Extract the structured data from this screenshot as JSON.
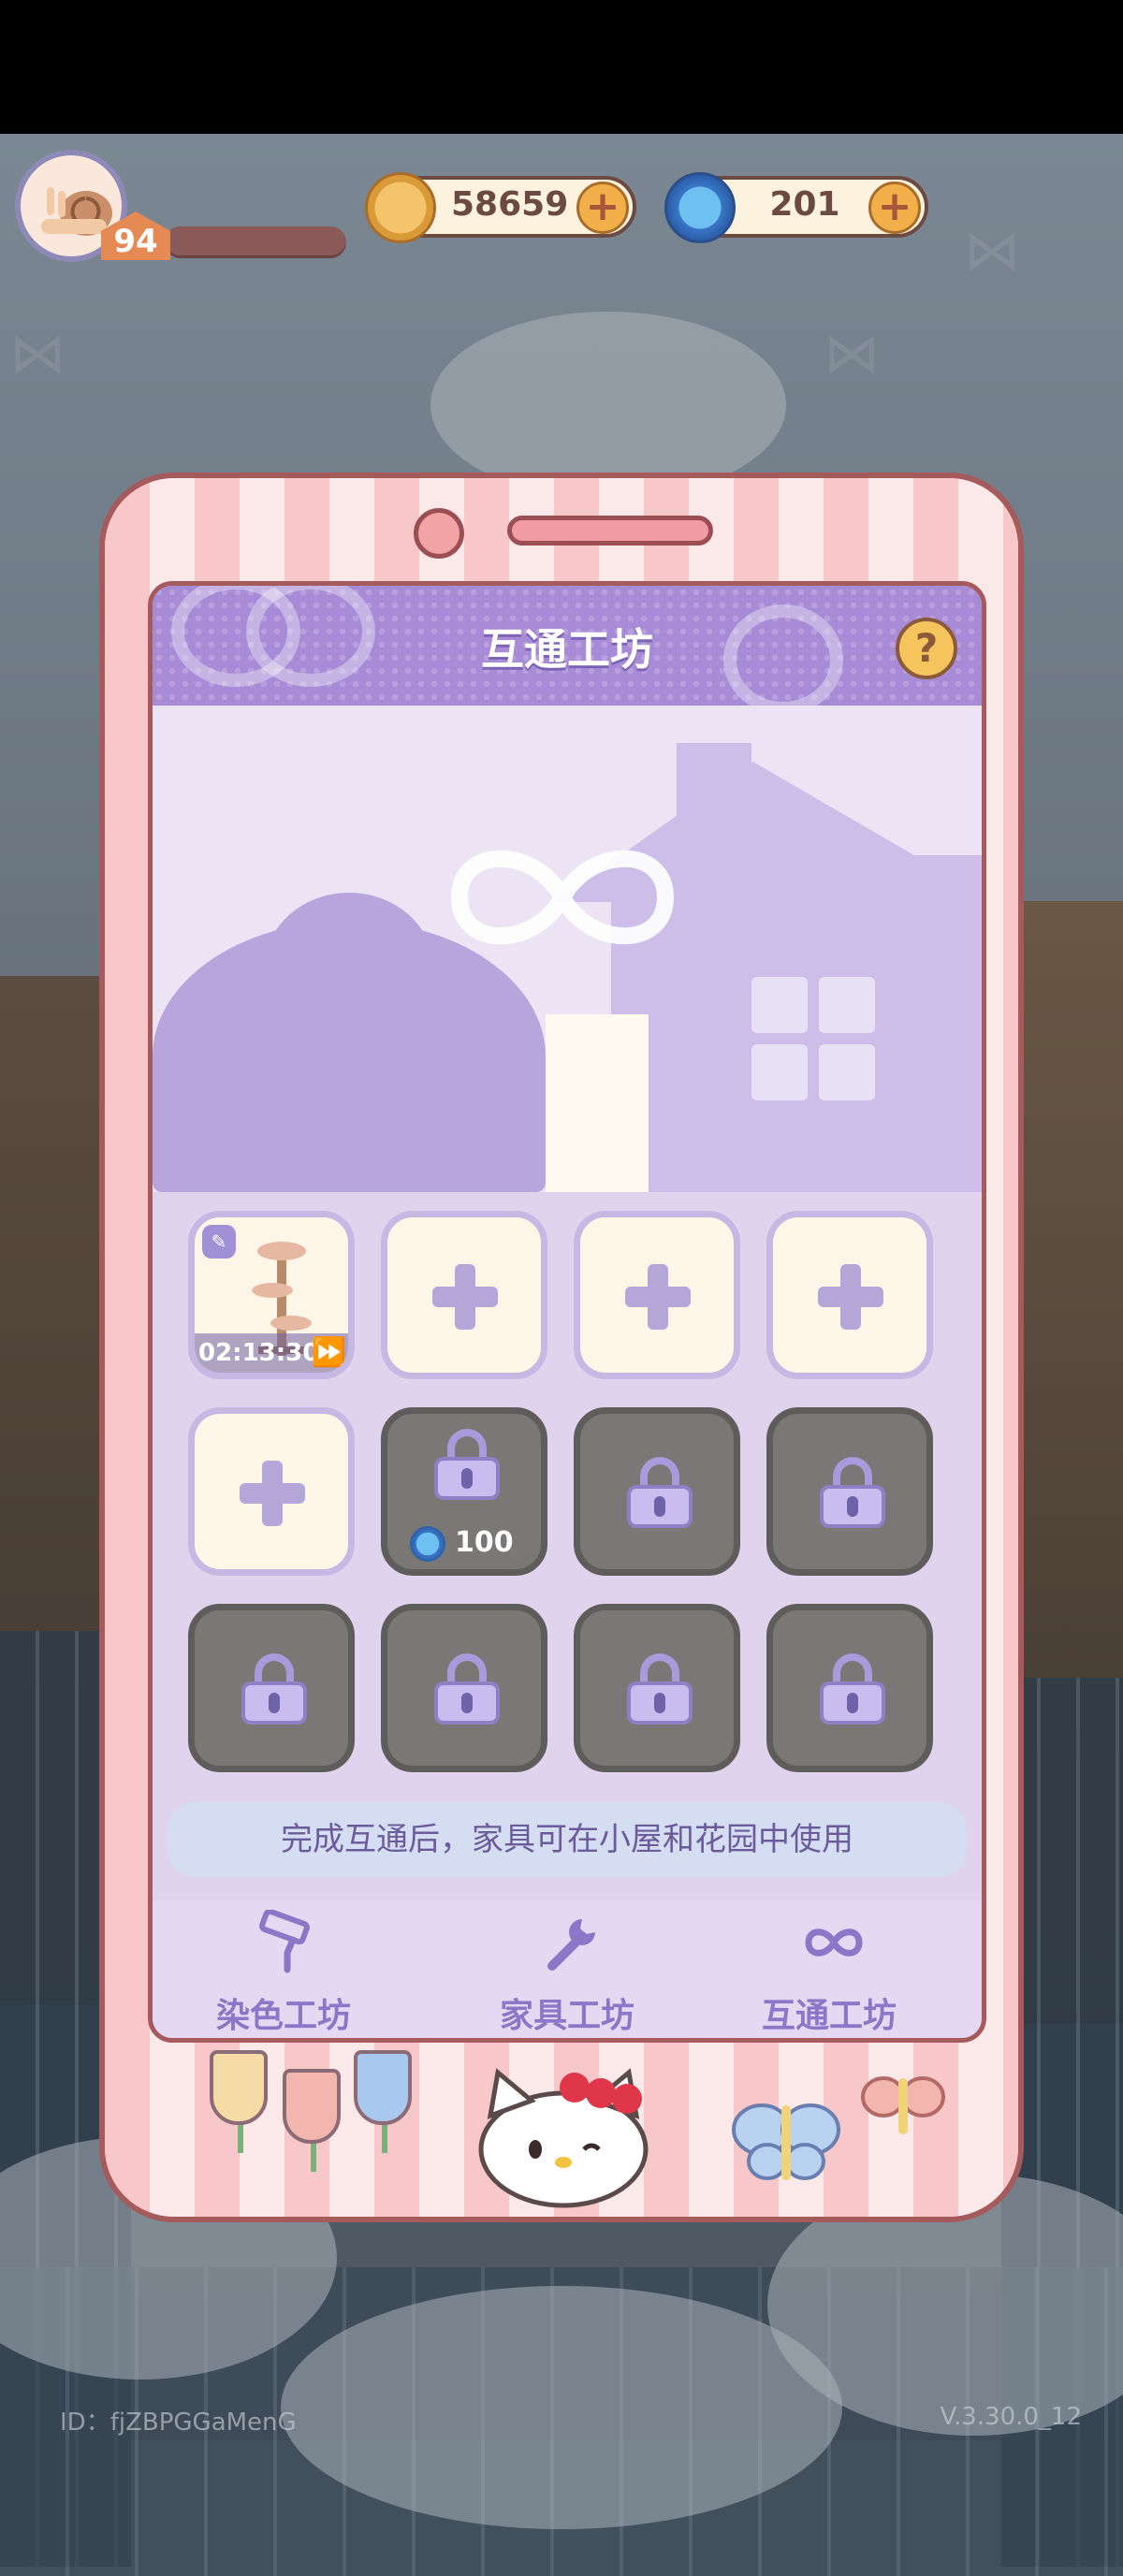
{
  "hud": {
    "level": "94",
    "coins": "58659",
    "gems": "201",
    "coin_icon": "clover-coin-icon",
    "gem_icon": "blue-swirl-icon"
  },
  "workshop": {
    "title": "互通工坊",
    "help_label": "?",
    "active_slot": {
      "timer": "02:13:30",
      "badge": "cat-badge"
    },
    "unlock_cost": "100",
    "info_text": "完成互通后，家具可在小屋和花园中使用"
  },
  "tabs": [
    {
      "label": "染色工坊",
      "icon": "paint-roller-icon"
    },
    {
      "label": "家具工坊",
      "icon": "wrench-icon"
    },
    {
      "label": "互通工坊",
      "icon": "infinity-loop-icon"
    }
  ],
  "footer": {
    "id_text": "ID：fjZBPGGaMenG",
    "version": "V.3.30.0_12"
  },
  "colors": {
    "title_bar": "#a78bd6",
    "screen_bg": "#dfd3ee",
    "frame_pink": "#f8c7c9",
    "frame_border": "#a55a5c",
    "tab_label": "#8d76c7",
    "locked_slot": "#7a7876"
  }
}
